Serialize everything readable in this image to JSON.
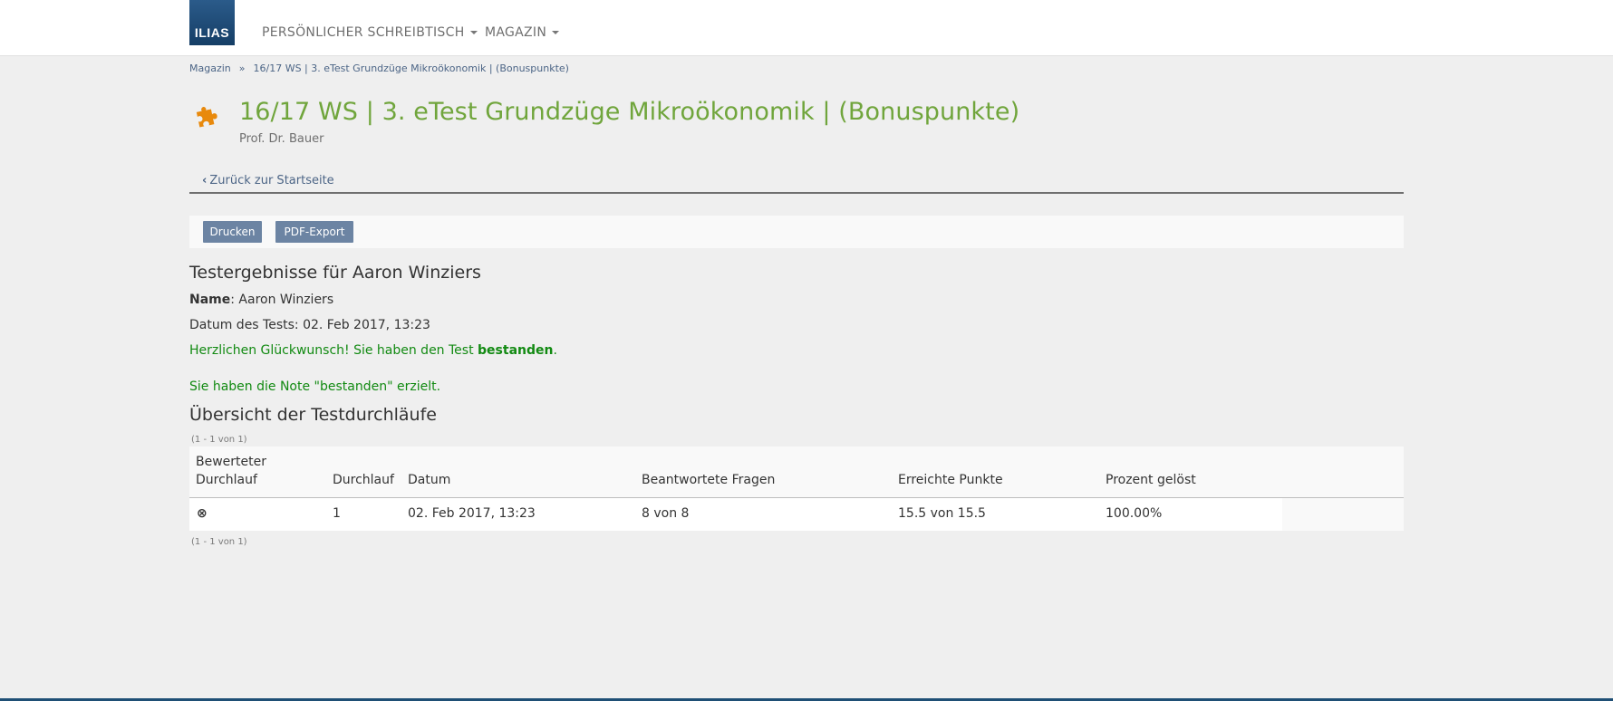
{
  "topbar": {
    "logo_text": "ILIAS",
    "nav": [
      {
        "label": "PERSÖNLICHER SCHREIBTISCH"
      },
      {
        "label": "MAGAZIN"
      }
    ]
  },
  "breadcrumb": {
    "items": [
      "Magazin",
      "16/17 WS | 3. eTest Grundzüge Mikroökonomik | (Bonuspunkte)"
    ],
    "separator": "»"
  },
  "header": {
    "icon": "puzzle-icon",
    "title": "16/17 WS | 3. eTest Grundzüge Mikroökonomik | (Bonuspunkte)",
    "subtitle": "Prof. Dr. Bauer"
  },
  "back_link": "Zurück zur Startseite",
  "toolbar": {
    "print_label": "Drucken",
    "pdf_label": "PDF-Export"
  },
  "results": {
    "heading": "Testergebnisse für Aaron Winziers",
    "name_label": "Name",
    "name_value": ": Aaron Winziers",
    "date_line": "Datum des Tests: 02. Feb 2017, 13:23",
    "congrats_prefix": "Herzlichen Glückwunsch! Sie haben den Test ",
    "congrats_bold": "bestanden",
    "congrats_suffix": ".",
    "grade_line": "Sie haben die Note \"bestanden\" erzielt."
  },
  "overview": {
    "heading": "Übersicht der Testdurchläufe",
    "pager_top": "(1 - 1 von 1)",
    "pager_bottom": "(1 - 1 von 1)",
    "columns": {
      "c1_line1": "Bewerteter",
      "c1_line2": "Durchlauf",
      "c2": "Durchlauf",
      "c3": "Datum",
      "c4": "Beantwortete Fragen",
      "c5": "Erreichte Punkte",
      "c6": "Prozent gelöst"
    },
    "rows": [
      {
        "scored_marker": "⊗",
        "run": "1",
        "date": "02. Feb 2017, 13:23",
        "answered": "8 von 8",
        "points": "15.5 von 15.5",
        "percent": "100.00%"
      }
    ]
  },
  "colors": {
    "title_green": "#70a53c",
    "success_green": "#128a12",
    "button_blue": "#6c84a3",
    "link_blue": "#4c6586",
    "puzzle_orange": "#e8890c"
  }
}
